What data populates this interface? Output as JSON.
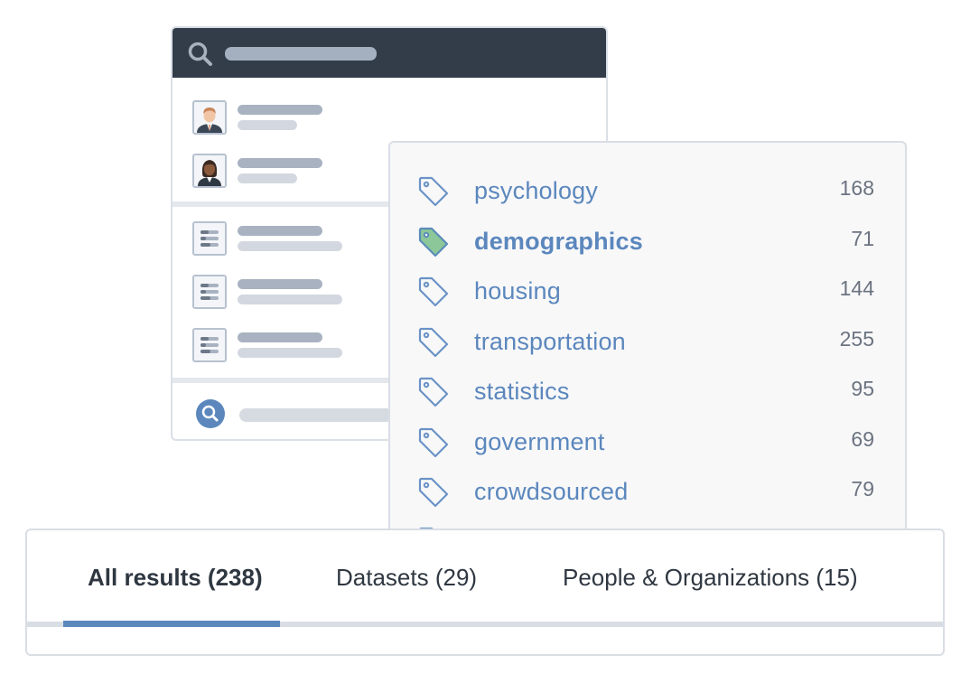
{
  "tags": [
    {
      "label": "psychology",
      "count": "168",
      "selected": false
    },
    {
      "label": "demographics",
      "count": "71",
      "selected": true
    },
    {
      "label": "housing",
      "count": "144",
      "selected": false
    },
    {
      "label": "transportation",
      "count": "255",
      "selected": false
    },
    {
      "label": "statistics",
      "count": "95",
      "selected": false
    },
    {
      "label": "government",
      "count": "69",
      "selected": false
    },
    {
      "label": "crowdsourced",
      "count": "79",
      "selected": false
    }
  ],
  "tabs": [
    {
      "label": "All results (238)",
      "active": true
    },
    {
      "label": "Datasets (29)",
      "active": false
    },
    {
      "label": "People & Organizations (15)",
      "active": false
    }
  ],
  "colors": {
    "header_bg": "#333d49",
    "link_blue": "#5b87bd",
    "selected_tag_fill": "#8cc79a",
    "tab_indicator": "#5b87bd"
  },
  "icons": {
    "header_search": "search-icon",
    "footer_search": "search-circle-icon",
    "tag": "tag-icon",
    "person": "person-avatar",
    "dataset": "dataset-icon"
  }
}
